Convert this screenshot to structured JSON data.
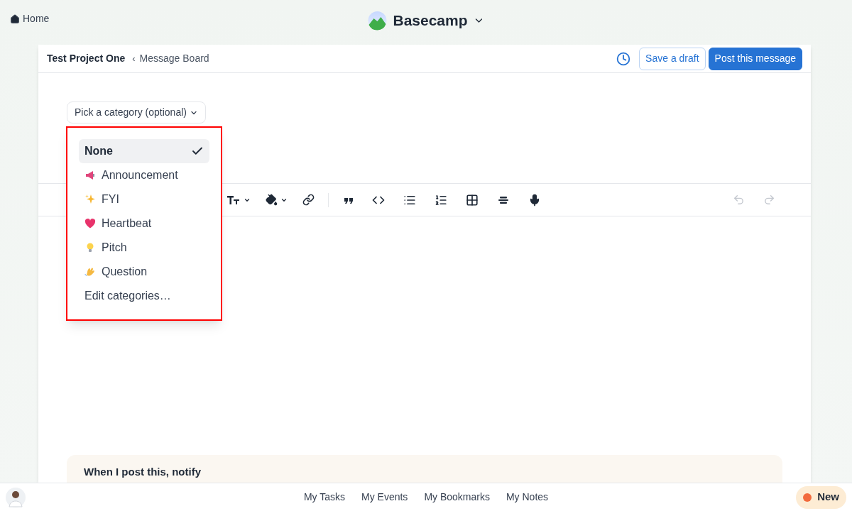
{
  "top_bar": {
    "home_link": "Home",
    "app_name": "Basecamp"
  },
  "header": {
    "project": "Test Project One",
    "separator": "‹",
    "page": "Message Board",
    "buttons": [
      {
        "label": "Save a draft",
        "kind": "secondary"
      },
      {
        "label": "Post this message",
        "kind": "primary"
      }
    ]
  },
  "category_picker": {
    "label": "Pick a category (optional)",
    "expanded": true,
    "options": [
      {
        "label": "None",
        "kind": "category",
        "selected": true
      },
      {
        "label": "Announcement",
        "kind": "category",
        "selected": false
      },
      {
        "label": "FYI",
        "kind": "category",
        "selected": false
      },
      {
        "label": "Heartbeat",
        "kind": "category",
        "selected": false
      },
      {
        "label": "Pitch",
        "kind": "category",
        "selected": false
      },
      {
        "label": "Question",
        "kind": "category",
        "selected": false
      },
      {
        "label": "Edit categories…",
        "kind": "action"
      }
    ]
  },
  "notify": {
    "heading": "When I post this, notify"
  },
  "footer": {
    "links": [
      "My Tasks",
      "My Events",
      "My Bookmarks",
      "My Notes"
    ],
    "new_button": "New"
  }
}
